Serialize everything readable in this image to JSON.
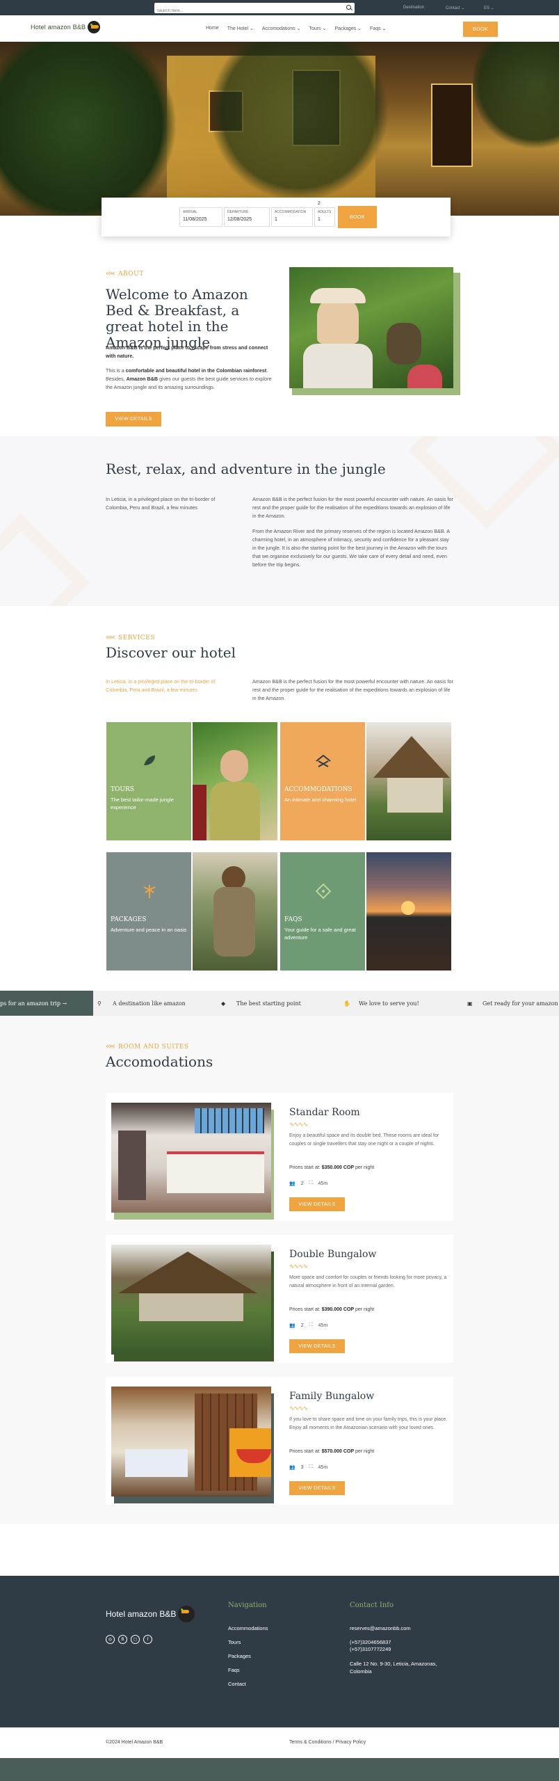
{
  "topbar": {
    "search_placeholder": "Search here...",
    "links": [
      "Destination",
      "Contact ⌄",
      "ES ⌄"
    ]
  },
  "header": {
    "logo_text": "Hotel amazon B&B",
    "nav": [
      "Home",
      "The Hotel",
      "Accomodations",
      "Tours",
      "Packages",
      "Faqs"
    ],
    "book_label": "BOOK"
  },
  "booking": {
    "arrival_label": "ARRIVAL",
    "arrival_value": "11/08/2025",
    "departure_label": "DEPARTURE",
    "departure_value": "12/08/2025",
    "accommodation_label": "ACCOMMODATION",
    "accommodation_value": "1",
    "adults_label": "ADULTS",
    "adults_value": "1",
    "adults_top": "2",
    "book_label": "BOOK"
  },
  "about": {
    "eyebrow": "ABOUT",
    "title": "Welcome to Amazon Bed & Breakfast, a great hotel in the Amazon jungle",
    "lead": "Amazon B&B is the perfect place to escape from stress and connect with nature.",
    "p1_a": "This is a ",
    "p1_b": "comfortable and beautiful hotel in the Colombian rainforest",
    "p1_c": ". Besides, ",
    "p1_d": "Amazon B&B",
    "p1_e": " gives our guests the best guide services to explore the Amazon jungle and its amazing surroundings.",
    "button": "VIEW DETAILS"
  },
  "relax": {
    "title": "Rest, relax, and adventure in the jungle",
    "left": "In Leticia, in a privileged place on the tri-border of Colombia, Peru and Brazil, a few minutes",
    "right1": "Amazon B&B is the perfect fusion for the most powerful encounter with nature. An oasis for rest and the proper guide for the realisation of the expeditions towards an explosion of life in the Amazon.",
    "right2": "From the Amazon River and the primary reserves of the region is located Amazon B&B. A charming hotel, in an atmosphere of intimacy, security and confidence for a pleasant stay in the jungle. It is also the starting point for the best journey in the Amazon with the tours that we organise exclusively for our guests. We take care of every detail and need, even before the trip begins."
  },
  "services": {
    "eyebrow": "SERVICES",
    "title": "Discover our hotel",
    "left": "In Leticia, in a privileged place on the tri-border of Colombia, Peru and Brazil, a few minutes",
    "right": "Amazon B&B is the perfect fusion for the most powerful encounter with nature. An oasis for rest and the proper guide for the realisation of the expeditions towards an explosion of life in the Amazon.",
    "tiles": [
      {
        "title": "TOURS",
        "sub": "The best tailor-made jungle experience"
      },
      {
        "title": "ACCOMMODATIONS",
        "sub": "An intimate and charming hotel"
      },
      {
        "title": "PACKAGES",
        "sub": "Adventure and peace in an oasis"
      },
      {
        "title": "FAQS",
        "sub": "Your guide for a safe and great adventure"
      }
    ]
  },
  "ticker": [
    "ps for an amazon trip →",
    "A destination like amazon",
    "The best starting point",
    "We love to serve you!",
    "Get ready for your amazon trip"
  ],
  "rooms": {
    "eyebrow": "ROOM AND SUITES",
    "title": "Accomodations",
    "price_label": "Prices start at: ",
    "button": "VIEW DETAILS",
    "items": [
      {
        "name": "Standar Room",
        "desc": "Enjoy a beautiful space and its double bed. These rooms are ideal for couples or single travellers that stay one night or a couple of nights.",
        "price": "$350.000 COP",
        "per": " per night",
        "guests": "2",
        "size": "45m"
      },
      {
        "name": "Double Bungalow",
        "desc": "More space and comfort for couples or friends looking for more privacy, a natural atmosphere in front of an internal garden.",
        "price": "$390.000 COP",
        "per": " per night",
        "guests": "2",
        "size": "45m"
      },
      {
        "name": "Family Bungalow",
        "desc": "If you love to share space and time on your family trips, this is your place. Enjoy all moments in the Amazonian scenario with your loved ones.",
        "price": "$570.000 COP",
        "per": " per night",
        "guests": "3",
        "size": "45m"
      }
    ]
  },
  "footer": {
    "logo_text": "Hotel amazon B&B",
    "nav_title": "Navigation",
    "nav": [
      "Accommodations",
      "Tours",
      "Packages",
      "Faqs",
      "Contact"
    ],
    "contact_title": "Contact Info",
    "email": "reserves@amazonbb.com",
    "phone1": "(+57)3204656837",
    "phone2": "(+57)3107772249",
    "address": "Calle 12 No. 9-30, Leticia, Amazonas, Colombia",
    "social": [
      "tripadvisor",
      "booking",
      "instagram",
      "facebook"
    ],
    "copyright": "©2024 Hotel Amazon B&B",
    "legal": "Terms & Conditions / Privacy Policy"
  },
  "colors": {
    "accent": "#f0a440",
    "dark": "#2f3b45",
    "green": "#8fb26c"
  }
}
